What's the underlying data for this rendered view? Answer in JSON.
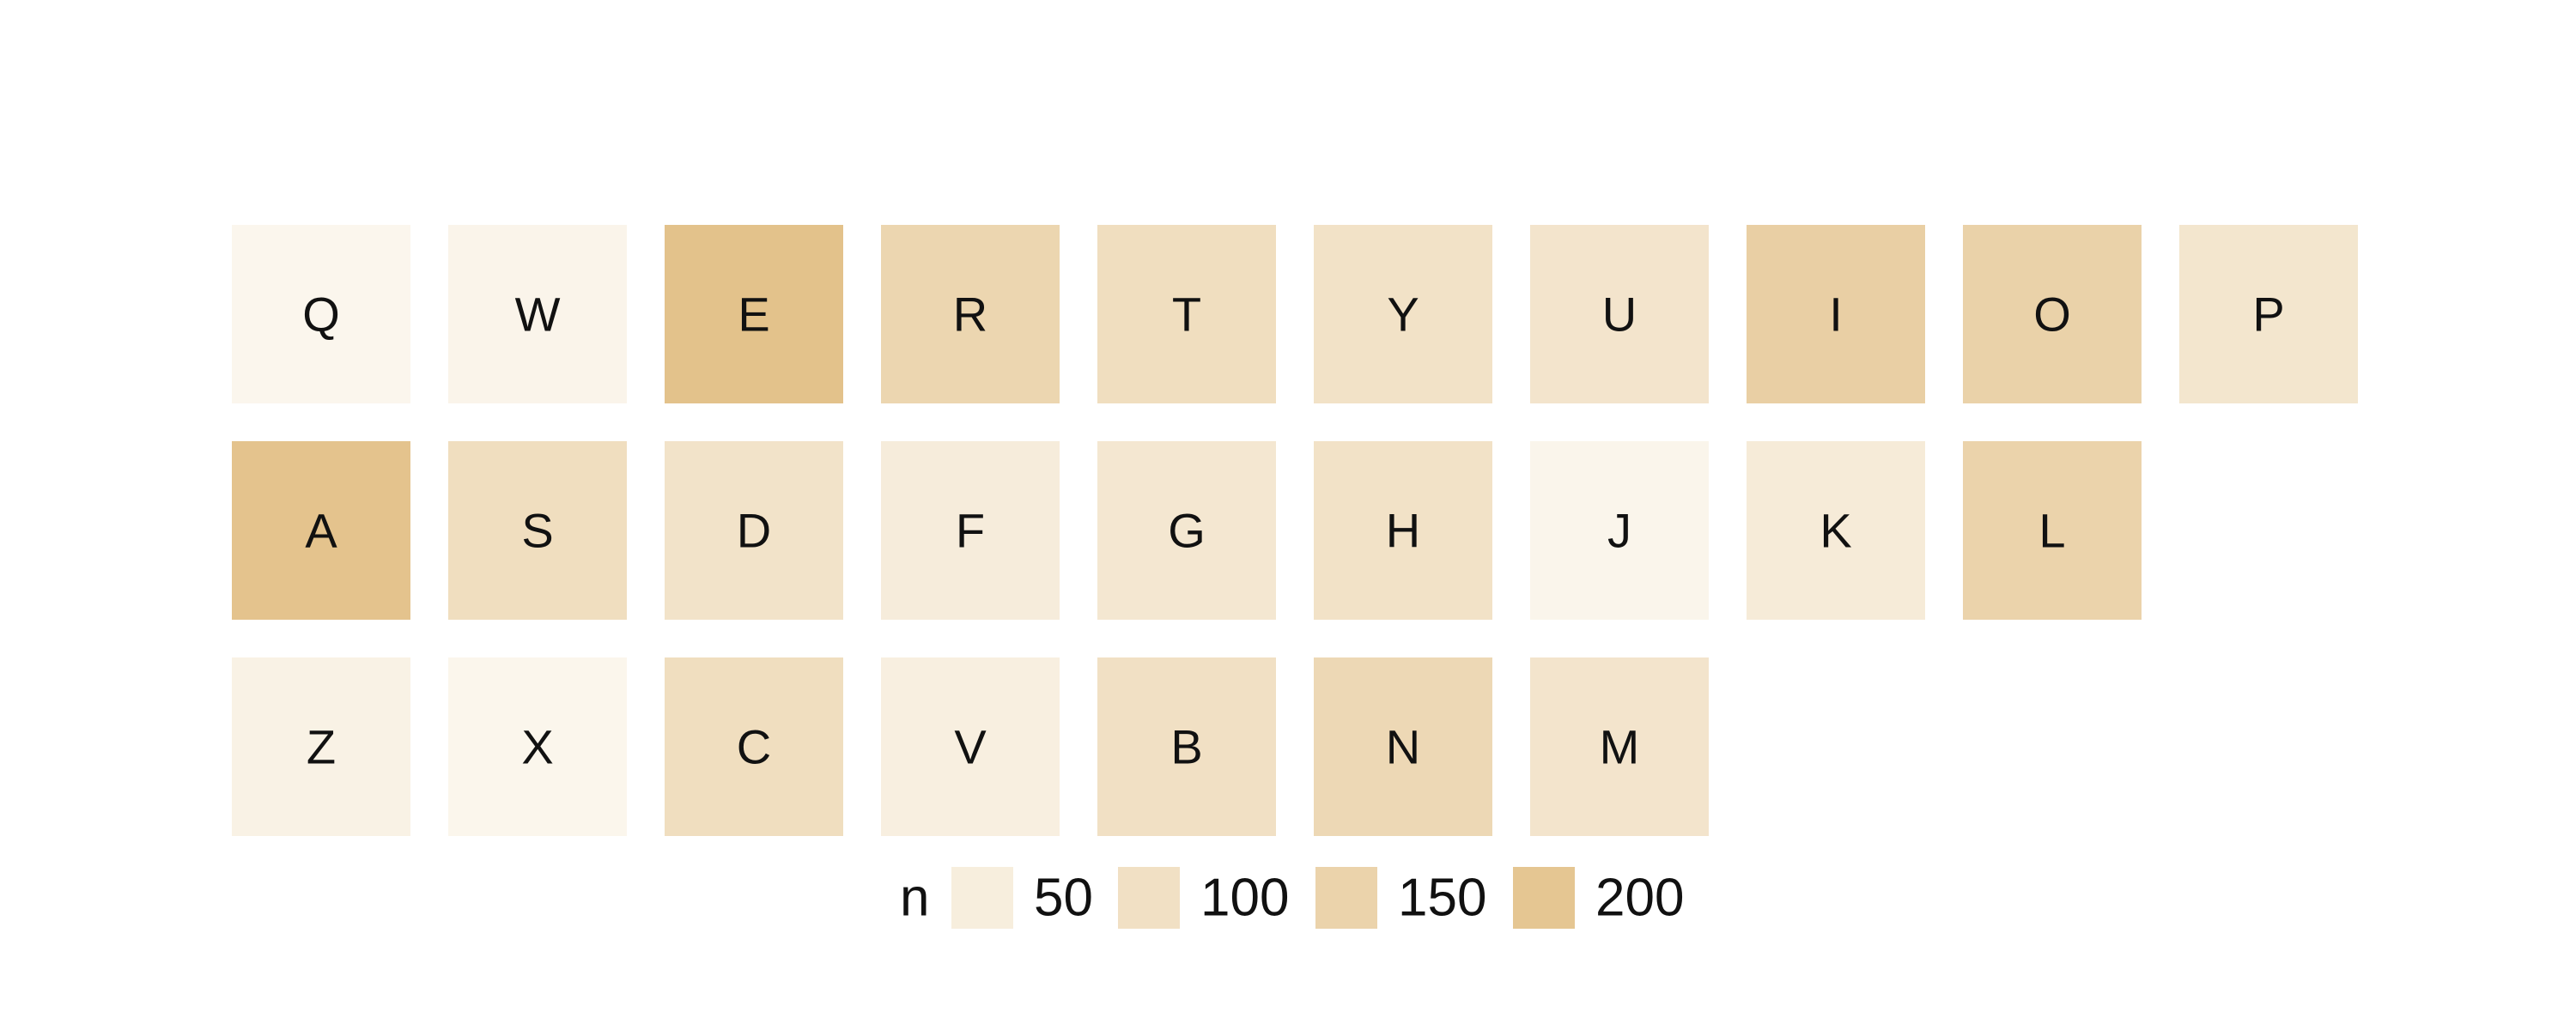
{
  "chart_data": {
    "type": "heatmap",
    "title": "",
    "xlabel": "",
    "ylabel": "",
    "rows": [
      [
        "Q",
        "W",
        "E",
        "R",
        "T",
        "Y",
        "U",
        "I",
        "O",
        "P"
      ],
      [
        "A",
        "S",
        "D",
        "F",
        "G",
        "H",
        "J",
        "K",
        "L"
      ],
      [
        "Z",
        "X",
        "C",
        "V",
        "B",
        "N",
        "M"
      ]
    ],
    "values": {
      "Q": 18,
      "W": 25,
      "E": 215,
      "R": 140,
      "T": 110,
      "Y": 95,
      "U": 85,
      "I": 165,
      "O": 155,
      "P": 80,
      "A": 210,
      "S": 110,
      "D": 90,
      "F": 55,
      "G": 75,
      "H": 95,
      "J": 22,
      "K": 60,
      "L": 150,
      "Z": 35,
      "X": 20,
      "C": 110,
      "V": 45,
      "B": 100,
      "N": 130,
      "M": 85
    },
    "color_scale": {
      "domain": [
        0,
        225
      ],
      "low_color": "#fdfbf6",
      "high_color": "#e2bf86"
    },
    "legend": {
      "title": "n",
      "placement": "bottom",
      "entries": [
        {
          "label": "50",
          "value": 50
        },
        {
          "label": "100",
          "value": 100
        },
        {
          "label": "150",
          "value": 150
        },
        {
          "label": "200",
          "value": 200
        }
      ]
    }
  }
}
